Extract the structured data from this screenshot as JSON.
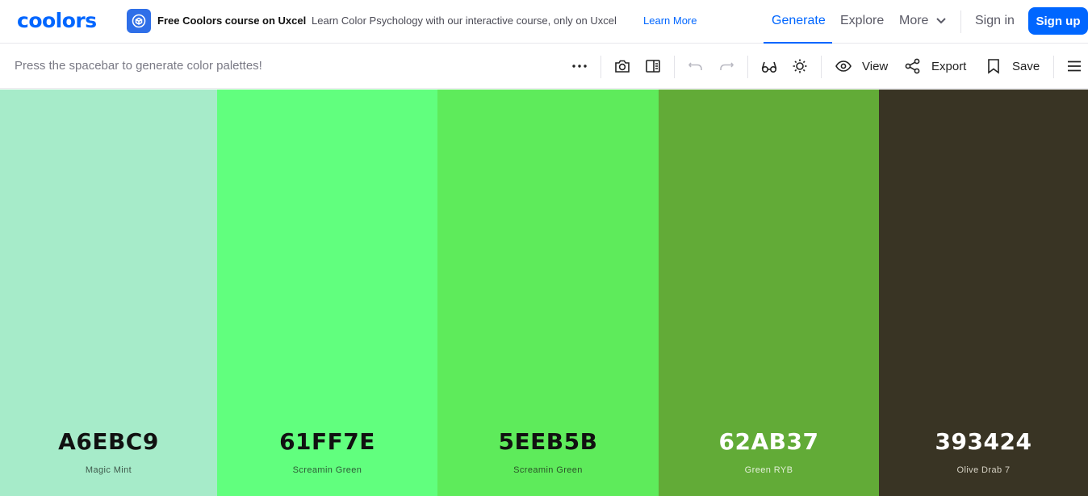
{
  "app": {
    "logo_text": "coolors"
  },
  "promo": {
    "title": "Free Coolors course on Uxcel",
    "description": "Learn Color Psychology with our interactive course, only on Uxcel",
    "link": "Learn More"
  },
  "nav": {
    "generate": "Generate",
    "explore": "Explore",
    "more": "More",
    "sign_in": "Sign in",
    "sign_up": "Sign up"
  },
  "toolbar": {
    "hint": "Press the spacebar to generate color palettes!",
    "view_label": "View",
    "export_label": "Export",
    "save_label": "Save"
  },
  "palette": [
    {
      "hex": "A6EBC9",
      "name": "Magic Mint",
      "color": "#A6EBC9",
      "text_color": "#111111",
      "name_color": "#3f5a4c"
    },
    {
      "hex": "61FF7E",
      "name": "Screamin Green",
      "color": "#61FF7E",
      "text_color": "#111111",
      "name_color": "#2d5b36"
    },
    {
      "hex": "5EEB5B",
      "name": "Screamin Green",
      "color": "#5EEB5B",
      "text_color": "#111111",
      "name_color": "#2b5429"
    },
    {
      "hex": "62AB37",
      "name": "Green RYB",
      "color": "#62AB37",
      "text_color": "#ffffff",
      "name_color": "#e3f0d8"
    },
    {
      "hex": "393424",
      "name": "Olive Drab 7",
      "color": "#393424",
      "text_color": "#ffffff",
      "name_color": "#d5d1c4"
    }
  ],
  "colors": {
    "accent": "#0066ff"
  }
}
